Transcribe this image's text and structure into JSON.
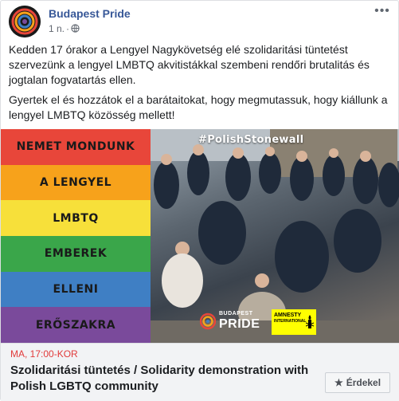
{
  "post": {
    "page_name": "Budapest Pride",
    "time": "1 n.",
    "privacy_icon": "globe-icon",
    "more_icon": "ellipsis-icon",
    "paragraphs": [
      "Kedden 17 órakor a Lengyel Nagykövetség elé szolidaritási tüntetést szervezünk a lengyel LMBTQ akvitistákkal szembeni rendőri brutalitás és jogtalan fogvatartás ellen.",
      "Gyertek el és hozzátok el a barátaitokat, hogy megmutassuk, hogy kiállunk a lengyel LMBTQ közösség mellett!"
    ]
  },
  "image": {
    "stripes": [
      {
        "text": "NEMET MONDUNK",
        "color": "#e8463a"
      },
      {
        "text": "A LENGYEL",
        "color": "#f7a21b"
      },
      {
        "text": "LMBTQ",
        "color": "#f7e03a"
      },
      {
        "text": "EMBEREK",
        "color": "#3aa64a"
      },
      {
        "text": "ELLENI",
        "color": "#3f7fc4"
      },
      {
        "text": "ERŐSZAKRA",
        "color": "#7a4a9b"
      }
    ],
    "hashtag": "#PolishStonewall",
    "logo_small": "BUDAPEST",
    "logo_big": "PRIDE",
    "amnesty_line1": "AMNESTY",
    "amnesty_line2": "INTERNATIONAL"
  },
  "event": {
    "time": "MA, 17:00-KOR",
    "title": "Szolidaritási tüntetés / Solidarity demonstration with Polish LGBTQ community",
    "interested_label": "Érdekel",
    "interested_icon": "star-icon"
  }
}
